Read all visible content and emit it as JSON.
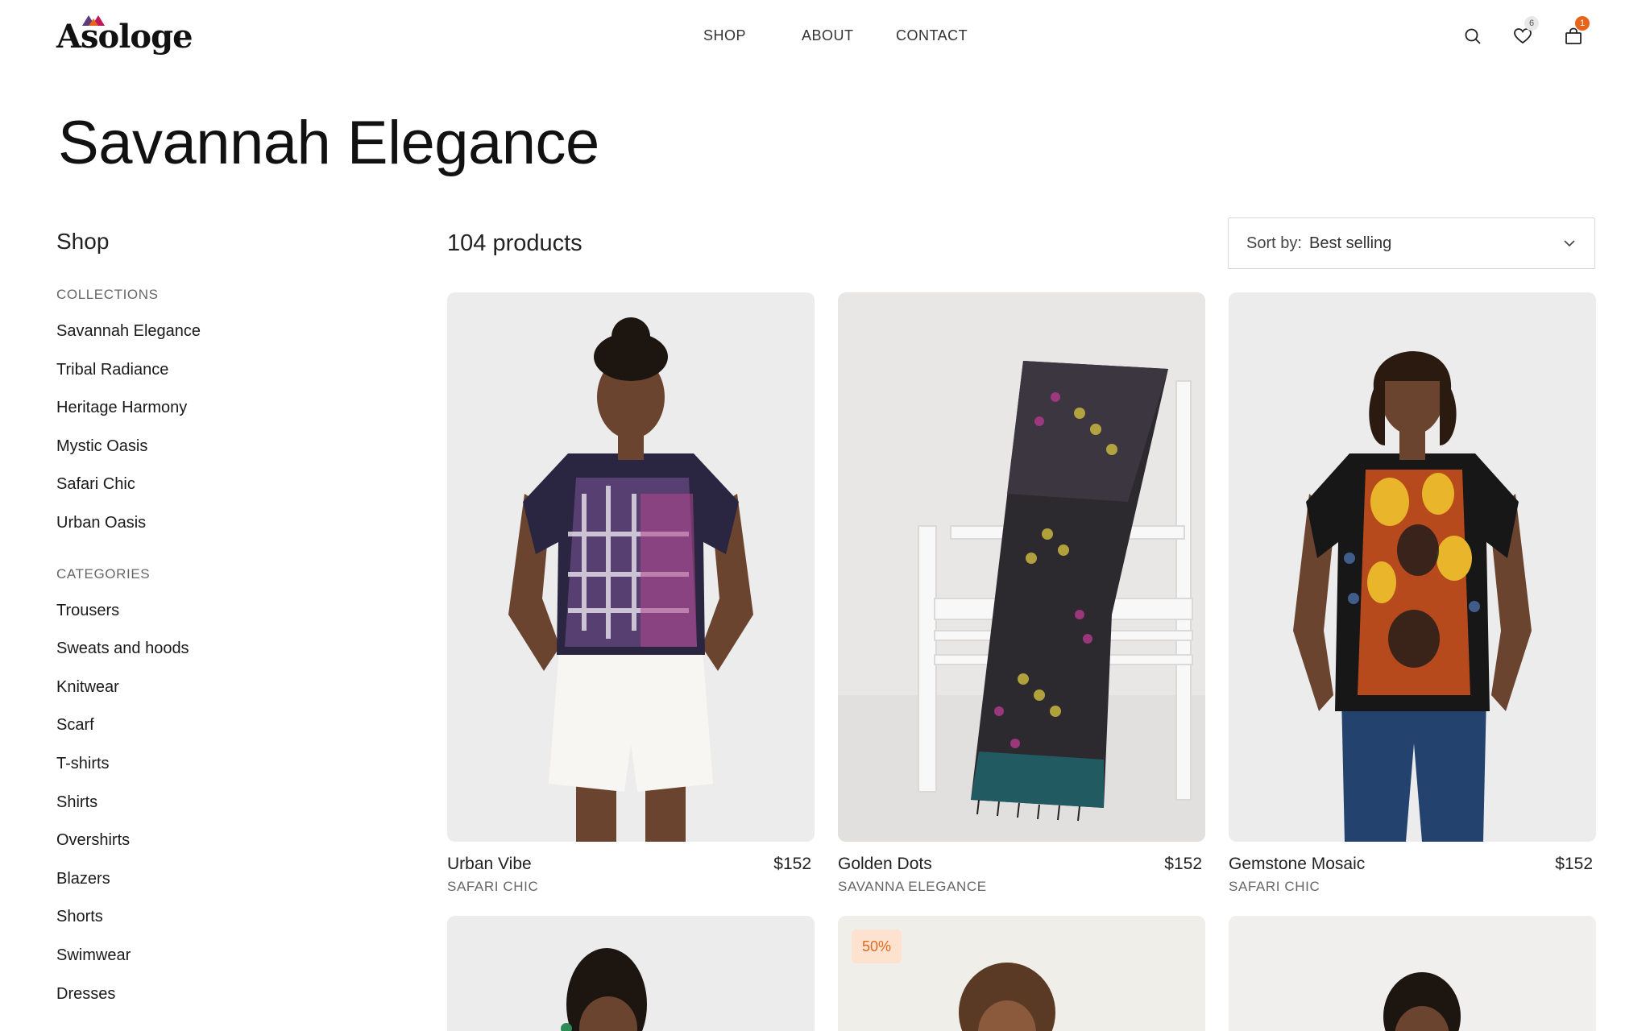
{
  "header": {
    "logo_text": "Asologe",
    "nav": [
      "SHOP",
      "ABOUT",
      "CONTACT"
    ],
    "wishlist_count": "6",
    "cart_count": "1",
    "icons": [
      "search-icon",
      "heart-icon",
      "shopping-bag-icon"
    ]
  },
  "page": {
    "title": "Savannah Elegance"
  },
  "sidebar": {
    "heading": "Shop",
    "collections_title": "COLLECTIONS",
    "collections": [
      "Savannah Elegance",
      "Tribal Radiance",
      "Heritage Harmony",
      "Mystic Oasis",
      "Safari Chic",
      "Urban Oasis"
    ],
    "categories_title": "CATEGORIES",
    "categories": [
      "Trousers",
      "Sweats and hoods",
      "Knitwear",
      "Scarf",
      "T-shirts",
      "Shirts",
      "Overshirts",
      "Blazers",
      "Shorts",
      "Swimwear",
      "Dresses"
    ]
  },
  "listing": {
    "count": "104 products",
    "sort_label": "Sort by:",
    "sort_value": "Best selling"
  },
  "products": [
    {
      "name": "Urban Vibe",
      "price": "$152",
      "collection": "SAFARI CHIC",
      "image": "model-purple-tie-dye-tee"
    },
    {
      "name": "Golden Dots",
      "price": "$152",
      "collection": "SAVANNA ELEGANCE",
      "image": "dotted-scarf-on-bench"
    },
    {
      "name": "Gemstone Mosaic",
      "price": "$152",
      "collection": "SAFARI CHIC",
      "image": "model-orange-mosaic-tee"
    }
  ],
  "next_row": [
    {
      "badge": "",
      "image": "model-portrait"
    },
    {
      "badge": "50%",
      "image": "model-portrait"
    },
    {
      "badge": "",
      "image": "model-portrait"
    }
  ],
  "colors": {
    "accent": "#e8641b",
    "sale_bg": "#fde3cf",
    "text": "#1a1a1a",
    "muted": "#666666"
  }
}
